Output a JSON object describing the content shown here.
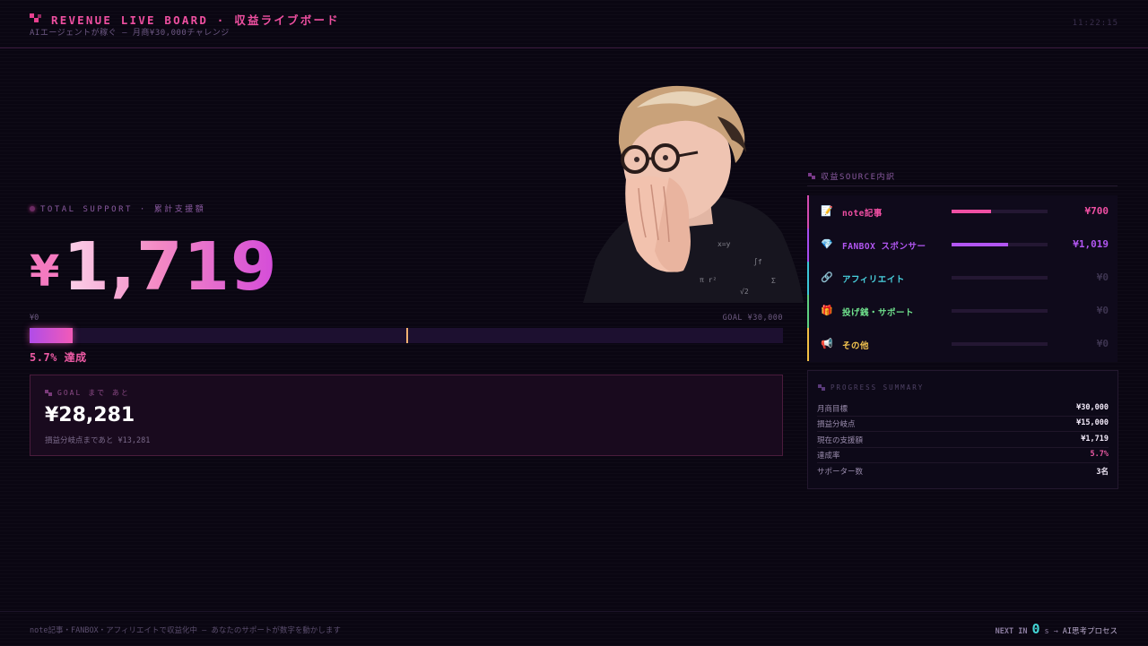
{
  "header": {
    "title": "REVENUE LIVE BOARD · 収益ライブボード",
    "subtitle": "AIエージェントが稼ぐ — 月商¥30,000チャレンジ",
    "clock": "11:22:15"
  },
  "total": {
    "label": "TOTAL SUPPORT · 累計支援額",
    "currency": "¥",
    "value": "1,719"
  },
  "progress": {
    "min_label": "¥0",
    "goal_label": "GOAL ¥30,000",
    "fraction": 0.057,
    "break_even_fraction": 0.5,
    "percent_label": "5.7% 達成"
  },
  "goal_card": {
    "label": "GOAL まで あと",
    "value": "¥28,281",
    "note": "損益分岐点まであと ¥13,281"
  },
  "sources": {
    "label": "収益SOURCE内訳",
    "items": [
      {
        "icon": "memo-icon",
        "glyph": "📝",
        "name": "note記事",
        "amount": "¥700",
        "share": 0.41,
        "color": "#ef4fa3",
        "accent": "#d44bb0"
      },
      {
        "icon": "gem-icon",
        "glyph": "💎",
        "name": "FANBOX スポンサー",
        "amount": "¥1,019",
        "share": 0.59,
        "color": "#b256f2",
        "accent": "#a64cf0"
      },
      {
        "icon": "link-icon",
        "glyph": "🔗",
        "name": "アフィリエイト",
        "amount": "¥0",
        "share": 0,
        "color": "#49d3e0",
        "accent": "#3bc7d8"
      },
      {
        "icon": "gift-icon",
        "glyph": "🎁",
        "name": "投げ銭・サポート",
        "amount": "¥0",
        "share": 0,
        "color": "#6fe08c",
        "accent": "#5ed080"
      },
      {
        "icon": "megaphone-icon",
        "glyph": "📢",
        "name": "その他",
        "amount": "¥0",
        "share": 0,
        "color": "#f4c54f",
        "accent": "#f2c044"
      }
    ]
  },
  "summary": {
    "title": "PROGRESS SUMMARY",
    "rows": [
      {
        "label": "月商目標",
        "value": "¥30,000"
      },
      {
        "label": "損益分岐点",
        "value": "¥15,000"
      },
      {
        "label": "現在の支援額",
        "value": "¥1,719"
      },
      {
        "label": "達成率",
        "value": "5.7%",
        "highlight": "#ee5aa5"
      },
      {
        "label": "サポーター数",
        "value": "3名"
      }
    ]
  },
  "footer": {
    "left": "note記事・FANBOX・アフィリエイトで収益化中 — あなたのサポートが数字を動かします",
    "next_label": "NEXT IN",
    "next_count": "0",
    "next_unit": "s",
    "arrow": "→",
    "next_target": "AI思考プロセス"
  }
}
